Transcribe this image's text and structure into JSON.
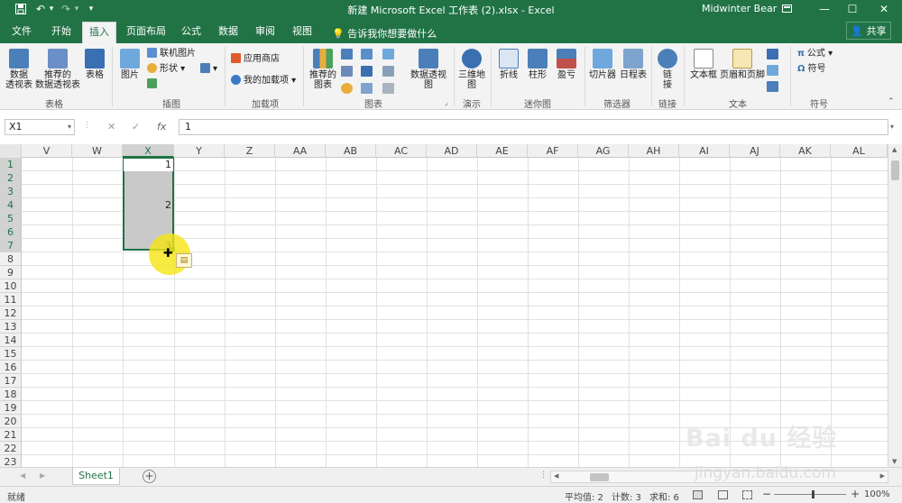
{
  "titlebar": {
    "save_icon": "save-icon",
    "undo_glyph": "↶",
    "redo_glyph": "↷",
    "customize_glyph": "▾",
    "doc_title": "新建 Microsoft Excel 工作表 (2).xlsx  -  Excel",
    "user": "Midwinter Bear",
    "brand_color": "#217346"
  },
  "tabs": [
    "文件",
    "开始",
    "插入",
    "页面布局",
    "公式",
    "数据",
    "审阅",
    "视图"
  ],
  "active_tab": "插入",
  "tell_me": "告诉我你想要做什么",
  "share": "共享",
  "ribbon": {
    "pivot_table": "数据\n透视表",
    "recommended_pivot": "推荐的\n数据透视表",
    "table": "表格",
    "pictures": "图片",
    "online_pictures": "联机图片",
    "shapes": "形状",
    "store": "应用商店",
    "my_addins": "我的加载项",
    "recommended_charts": "推荐的\n图表",
    "pivot_chart": "数据透视图",
    "map_3d": "三维地\n图",
    "line": "折线",
    "column": "柱形",
    "win_loss": "盈亏",
    "slicer": "切片器",
    "timeline": "日程表",
    "link": "链\n接",
    "textbox": "文本框",
    "header_footer": "页眉和页脚",
    "equation": "公式",
    "symbol": "符号",
    "groups": {
      "tables": "表格",
      "illustrations": "插图",
      "addins": "加载项",
      "charts": "图表",
      "tours": "演示",
      "sparklines": "迷你图",
      "filters": "筛选器",
      "links": "链接",
      "text": "文本",
      "symbols": "符号"
    }
  },
  "formula_bar": {
    "name_box": "X1",
    "cancel": "✕",
    "enter": "✓",
    "fx": "fx",
    "value": "1"
  },
  "columns": [
    "V",
    "W",
    "X",
    "Y",
    "Z",
    "AA",
    "AB",
    "AC",
    "AD",
    "AE",
    "AF",
    "AG",
    "AH",
    "AI",
    "AJ",
    "AK",
    "AL"
  ],
  "rows": [
    "1",
    "2",
    "3",
    "4",
    "5",
    "6",
    "7",
    "8",
    "9",
    "10",
    "11",
    "12",
    "13",
    "14",
    "15",
    "16",
    "17",
    "18",
    "19",
    "20",
    "21",
    "22",
    "23"
  ],
  "cells": {
    "x1": "1",
    "x4": "2",
    "x7": "3"
  },
  "sheet_tab": "Sheet1",
  "status": {
    "ready": "就绪",
    "average": "平均值: 2",
    "count": "计数: 3",
    "sum": "求和: 6",
    "zoom": "100%"
  },
  "watermark": {
    "brand": "Bai du 经验",
    "url": "jingyan.baidu.com"
  }
}
